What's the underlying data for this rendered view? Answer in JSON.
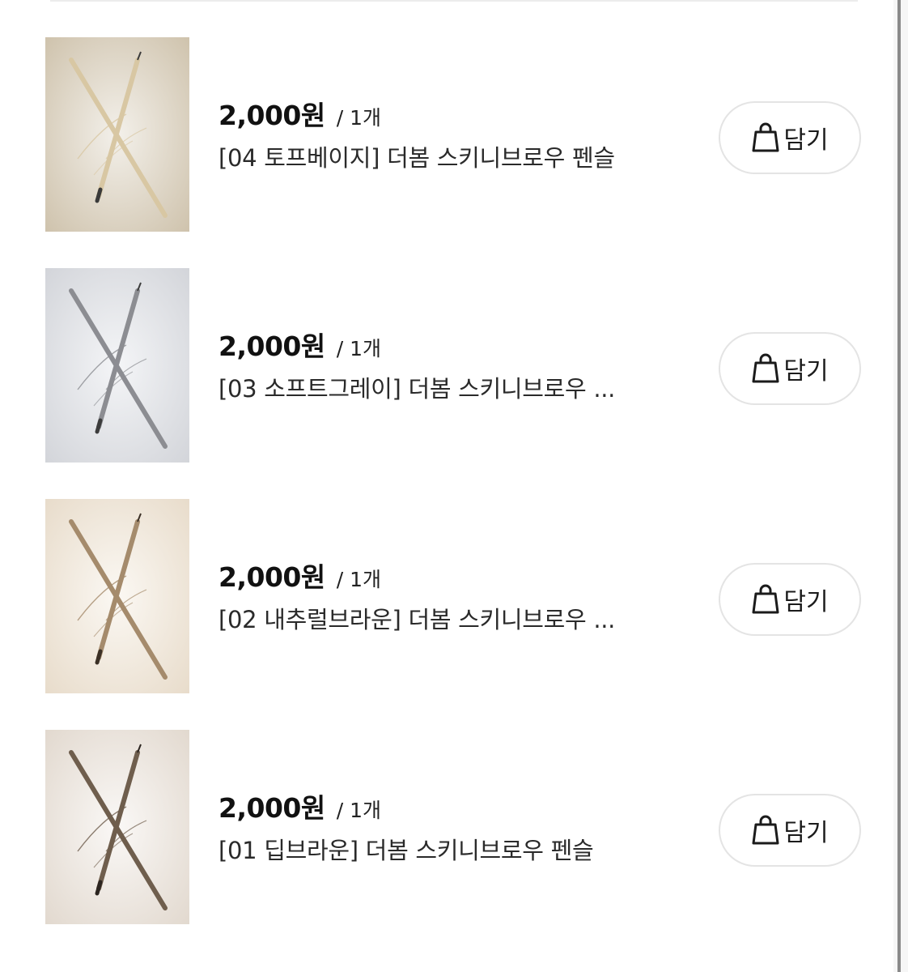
{
  "items": [
    {
      "price": "2,000원",
      "unit": "/ 1개",
      "name": "[04 토프베이지] 더봄 스키니브로우 펜슬",
      "cart_label": "담기",
      "bg_light": "#f3f0ea",
      "bg_dark": "#cfc3ad",
      "pencil_color": "#d8c7a3",
      "tip_color": "#3a3a3a"
    },
    {
      "price": "2,000원",
      "unit": "/ 1개",
      "name": "[03 소프트그레이] 더봄 스키니브로우 ...",
      "cart_label": "담기",
      "bg_light": "#f4f5f7",
      "bg_dark": "#d3d5da",
      "pencil_color": "#8c8d92",
      "tip_color": "#3c3c3c"
    },
    {
      "price": "2,000원",
      "unit": "/ 1개",
      "name": "[02 내추럴브라운] 더봄 스키니브로우 ...",
      "cart_label": "담기",
      "bg_light": "#fbf8f3",
      "bg_dark": "#e8dccb",
      "pencil_color": "#a58b6c",
      "tip_color": "#3b3026"
    },
    {
      "price": "2,000원",
      "unit": "/ 1개",
      "name": "[01 딥브라운] 더봄 스키니브로우 펜슬",
      "cart_label": "담기",
      "bg_light": "#faf8f6",
      "bg_dark": "#e2d9cf",
      "pencil_color": "#6f5e4d",
      "tip_color": "#2c2520"
    }
  ],
  "icons": {
    "cart": "shopping-bag-icon"
  }
}
